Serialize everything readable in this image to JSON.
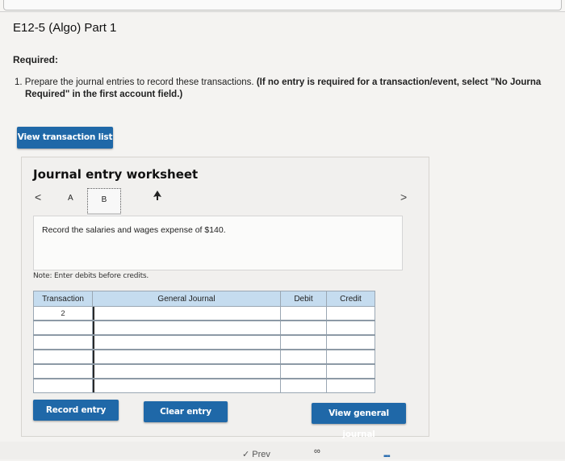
{
  "page": {
    "title": "E12-5 (Algo) Part 1",
    "required_label": "Required:",
    "instruction_number": "1.",
    "instruction_text": "Prepare the journal entries to record these transactions.",
    "instruction_bold": "(If no entry is required for a transaction/event, select \"No Journa",
    "instruction_bold_2": "Required\" in the first account field.)"
  },
  "buttons": {
    "view_transaction_list": "View transaction list",
    "record_entry": "Record entry",
    "clear_entry": "Clear entry",
    "view_general_journal": "View general journal"
  },
  "worksheet": {
    "title": "Journal entry worksheet",
    "tabs": [
      {
        "label": "A"
      },
      {
        "label": "B"
      }
    ],
    "nav_prev": "<",
    "nav_next": ">",
    "description": "Record the salaries and wages expense of $140.",
    "note": "Note: Enter debits before credits."
  },
  "journal_table": {
    "headers": [
      "Transaction",
      "General Journal",
      "Debit",
      "Credit"
    ],
    "rows": [
      {
        "transaction": "2",
        "account": "",
        "debit": "",
        "credit": ""
      },
      {
        "transaction": "",
        "account": "",
        "debit": "",
        "credit": ""
      },
      {
        "transaction": "",
        "account": "",
        "debit": "",
        "credit": ""
      },
      {
        "transaction": "",
        "account": "",
        "debit": "",
        "credit": ""
      },
      {
        "transaction": "",
        "account": "",
        "debit": "",
        "credit": ""
      },
      {
        "transaction": "",
        "account": "",
        "debit": "",
        "credit": ""
      }
    ]
  },
  "footer": {
    "prev_label": "Prev"
  },
  "colors": {
    "button_blue": "#1f68a8",
    "table_header": "#c5dcef"
  }
}
